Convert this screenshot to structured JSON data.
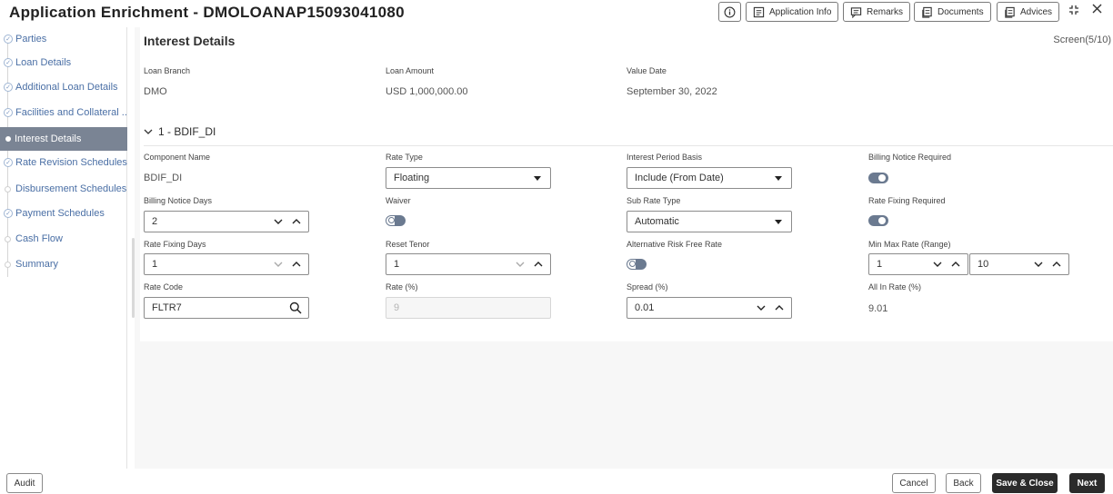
{
  "header": {
    "title": "Application Enrichment - DMOLOANAP15093041080",
    "buttons": {
      "info_icon": "info-icon",
      "application_info": "Application Info",
      "remarks": "Remarks",
      "documents": "Documents",
      "advices": "Advices"
    }
  },
  "sidebar": {
    "items": [
      {
        "label": "Parties",
        "state": "done"
      },
      {
        "label": "Loan Details",
        "state": "done"
      },
      {
        "label": "Additional Loan Details",
        "state": "done"
      },
      {
        "label": "Facilities and Collateral ...",
        "state": "done"
      },
      {
        "label": "Interest Details",
        "state": "active"
      },
      {
        "label": "Rate Revision Schedules",
        "state": "done"
      },
      {
        "label": "Disbursement Schedules",
        "state": "empty"
      },
      {
        "label": "Payment Schedules",
        "state": "done"
      },
      {
        "label": "Cash Flow",
        "state": "empty"
      },
      {
        "label": "Summary",
        "state": "empty"
      }
    ]
  },
  "main": {
    "title": "Interest Details",
    "screen_indicator": "Screen(5/10)",
    "summary": {
      "loan_branch_label": "Loan Branch",
      "loan_branch_value": "DMO",
      "loan_amount_label": "Loan Amount",
      "loan_amount_value": "USD 1,000,000.00",
      "value_date_label": "Value Date",
      "value_date_value": "September 30, 2022"
    },
    "section": {
      "title": "1 - BDIF_DI",
      "component_name_label": "Component Name",
      "component_name_value": "BDIF_DI",
      "rate_type_label": "Rate Type",
      "rate_type_value": "Floating",
      "interest_period_basis_label": "Interest Period Basis",
      "interest_period_basis_value": "Include (From Date)",
      "billing_notice_required_label": "Billing Notice Required",
      "billing_notice_required_on": true,
      "billing_notice_days_label": "Billing Notice Days",
      "billing_notice_days_value": "2",
      "waiver_label": "Waiver",
      "waiver_on": false,
      "sub_rate_type_label": "Sub Rate Type",
      "sub_rate_type_value": "Automatic",
      "rate_fixing_required_label": "Rate Fixing Required",
      "rate_fixing_required_on": true,
      "rate_fixing_days_label": "Rate Fixing Days",
      "rate_fixing_days_value": "1",
      "reset_tenor_label": "Reset Tenor",
      "reset_tenor_value": "1",
      "alt_risk_free_rate_label": "Alternative Risk Free Rate",
      "alt_risk_free_rate_on": false,
      "min_max_rate_label": "Min Max Rate (Range)",
      "min_rate_value": "1",
      "max_rate_value": "10",
      "rate_code_label": "Rate Code",
      "rate_code_value": "FLTR7",
      "rate_label": "Rate (%)",
      "rate_value": "9",
      "spread_label": "Spread (%)",
      "spread_value": "0.01",
      "all_in_rate_label": "All In Rate (%)",
      "all_in_rate_value": "9.01"
    }
  },
  "footer": {
    "audit": "Audit",
    "cancel": "Cancel",
    "back": "Back",
    "save_close": "Save & Close",
    "next": "Next"
  },
  "colors": {
    "active_nav": "#7a8494",
    "toggle": "#6b7a90",
    "link": "#4a6fa5",
    "primary_button": "#2b2b2b"
  }
}
